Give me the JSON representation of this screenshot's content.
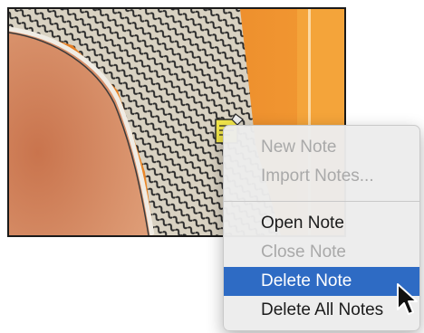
{
  "menu": {
    "items": [
      {
        "label": "New Note",
        "state": "disabled"
      },
      {
        "label": "Import Notes...",
        "state": "disabled"
      },
      {
        "label": "Open Note",
        "state": "enabled"
      },
      {
        "label": "Close Note",
        "state": "disabled"
      },
      {
        "label": "Delete Note",
        "state": "highlighted"
      },
      {
        "label": "Delete All Notes",
        "state": "enabled"
      }
    ]
  },
  "icons": {
    "note": "note-icon",
    "cursor": "arrow-cursor-icon"
  },
  "colors": {
    "highlight": "#2e6bc4",
    "photo_orange": "#ef8a2a",
    "skin": "#d98a5f",
    "note_yellow": "#f2e64a"
  }
}
